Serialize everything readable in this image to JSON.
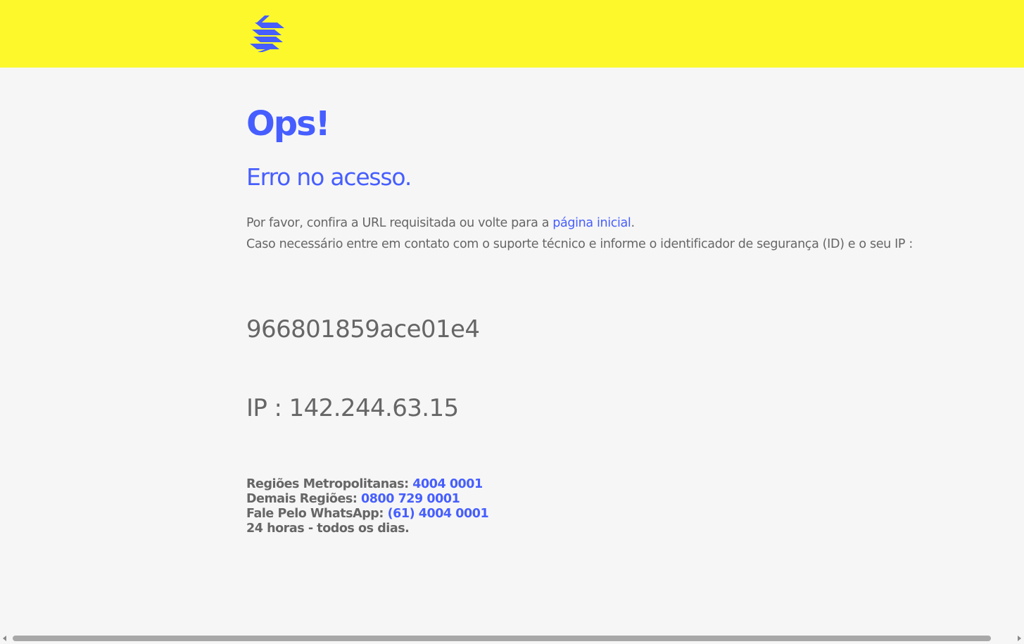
{
  "header": {
    "logo_icon": "banco-do-brasil-logo-icon",
    "background_color": "#fcf82c",
    "logo_color": "#465eff"
  },
  "main": {
    "title": "Ops!",
    "subtitle": "Erro no acesso.",
    "message_line1_prefix": "Por favor, confira a URL requisitada ou volte para a ",
    "home_link_label": "página inicial",
    "message_line1_suffix": ".",
    "message_line2": "Caso necessário entre em contato com o suporte técnico e informe o identificador de segurança (ID) e o seu IP :",
    "security_id": "966801859ace01e4",
    "ip_label": "IP : ",
    "ip_value": "142.244.63.15"
  },
  "contacts": {
    "metro_label": "Regiões Metropolitanas: ",
    "metro_phone": "4004 0001",
    "other_label": "Demais Regiões: ",
    "other_phone": "0800 729 0001",
    "whatsapp_label": "Fale Pelo WhatsApp: ",
    "whatsapp_phone": "(61) 4004 0001",
    "hours": "24 horas - todos os dias."
  },
  "colors": {
    "accent": "#465eff",
    "text": "#666666",
    "page_background": "#f6f6f6"
  }
}
